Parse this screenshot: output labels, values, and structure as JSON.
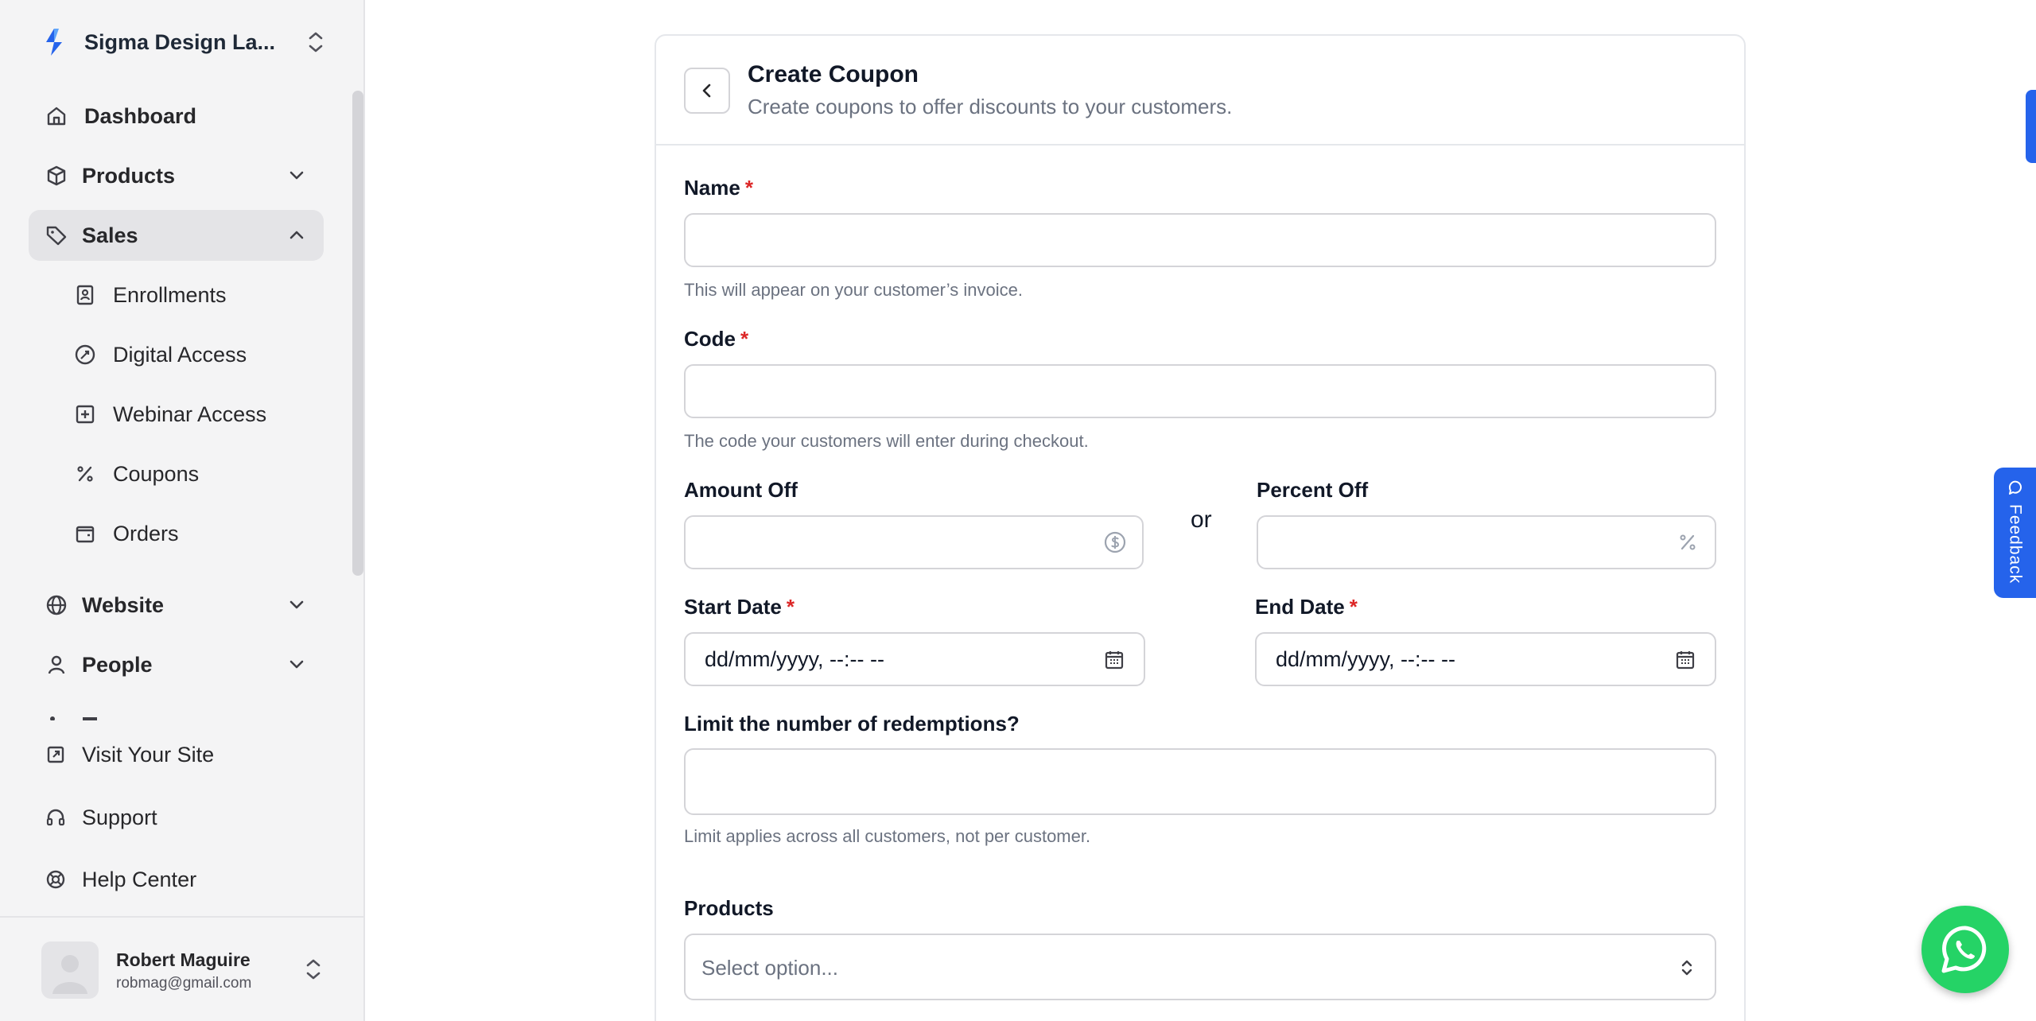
{
  "sidebar": {
    "workspace": "Sigma Design La...",
    "nav": [
      {
        "label": "Dashboard"
      },
      {
        "label": "Products"
      },
      {
        "label": "Sales"
      }
    ],
    "sales_sub": [
      {
        "label": "Enrollments"
      },
      {
        "label": "Digital Access"
      },
      {
        "label": "Webinar Access"
      },
      {
        "label": "Coupons"
      },
      {
        "label": "Orders"
      }
    ],
    "nav2": [
      {
        "label": "Website"
      },
      {
        "label": "People"
      }
    ],
    "bottom": [
      {
        "label": "Visit Your Site"
      },
      {
        "label": "Support"
      },
      {
        "label": "Help Center"
      }
    ],
    "user": {
      "name": "Robert Maguire",
      "email": "robmag@gmail.com"
    }
  },
  "form": {
    "title": "Create Coupon",
    "subtitle": "Create coupons to offer discounts to your customers.",
    "name": {
      "label": "Name",
      "required": "*",
      "value": "",
      "hint": "This will appear on your customer’s invoice."
    },
    "code": {
      "label": "Code",
      "required": "*",
      "value": "",
      "hint": "The code your customers will enter during checkout."
    },
    "amount_off": {
      "label": "Amount Off",
      "value": ""
    },
    "or_text": "or",
    "percent_off": {
      "label": "Percent Off",
      "value": ""
    },
    "start_date": {
      "label": "Start Date",
      "required": "*",
      "placeholder": "dd/mm/yyyy, --:-- --"
    },
    "end_date": {
      "label": "End Date",
      "required": "*",
      "placeholder": "dd/mm/yyyy, --:-- --"
    },
    "limit": {
      "label": "Limit the number of redemptions?",
      "value": "",
      "hint": "Limit applies across all customers, not per customer."
    },
    "products": {
      "label": "Products",
      "placeholder": "Select option..."
    }
  },
  "widgets": {
    "feedback_label": "Feedback"
  },
  "colors": {
    "accent": "#2563eb",
    "required": "#dc2626",
    "whatsapp": "#25d366",
    "sidebar_bg": "#f4f4f5"
  }
}
